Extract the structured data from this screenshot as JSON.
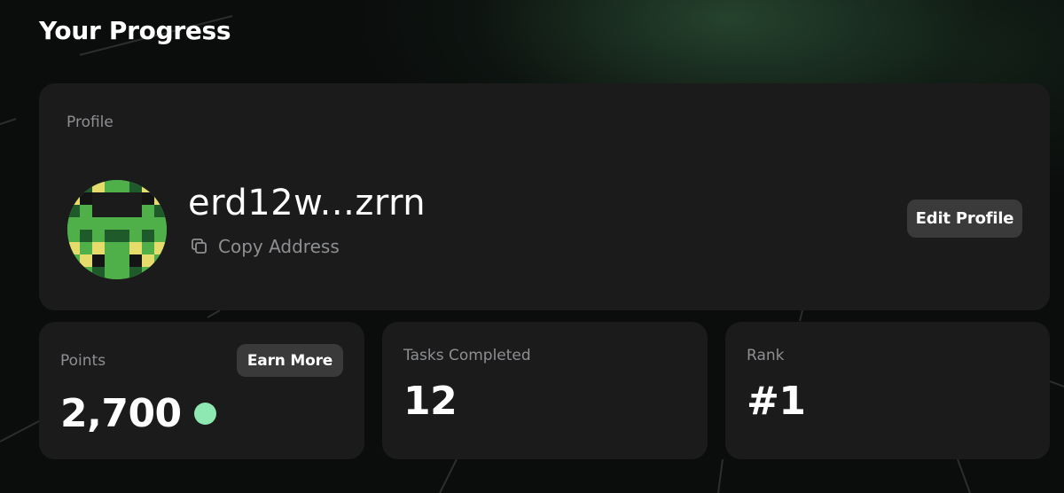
{
  "page": {
    "title": "Your Progress"
  },
  "profile": {
    "label": "Profile",
    "username": "erd12w...zrrn",
    "copy_label": "Copy Address",
    "edit_label": "Edit Profile",
    "copy_icon": "copy-icon",
    "avatar_colors": {
      "green": "#4fb04a",
      "dark": "#1f5a2a",
      "yellow": "#e6dc6c",
      "black": "#141414"
    }
  },
  "stats": {
    "points": {
      "label": "Points",
      "value": "2,700",
      "earn_label": "Earn More",
      "dot_color": "#8ee8b2"
    },
    "tasks": {
      "label": "Tasks Completed",
      "value": "12"
    },
    "rank": {
      "label": "Rank",
      "value": "#1"
    }
  },
  "colors": {
    "background": "#0b0d0c",
    "card": "#1b1b1b",
    "button": "#3a3a3a",
    "muted_text": "#8d8f92"
  }
}
